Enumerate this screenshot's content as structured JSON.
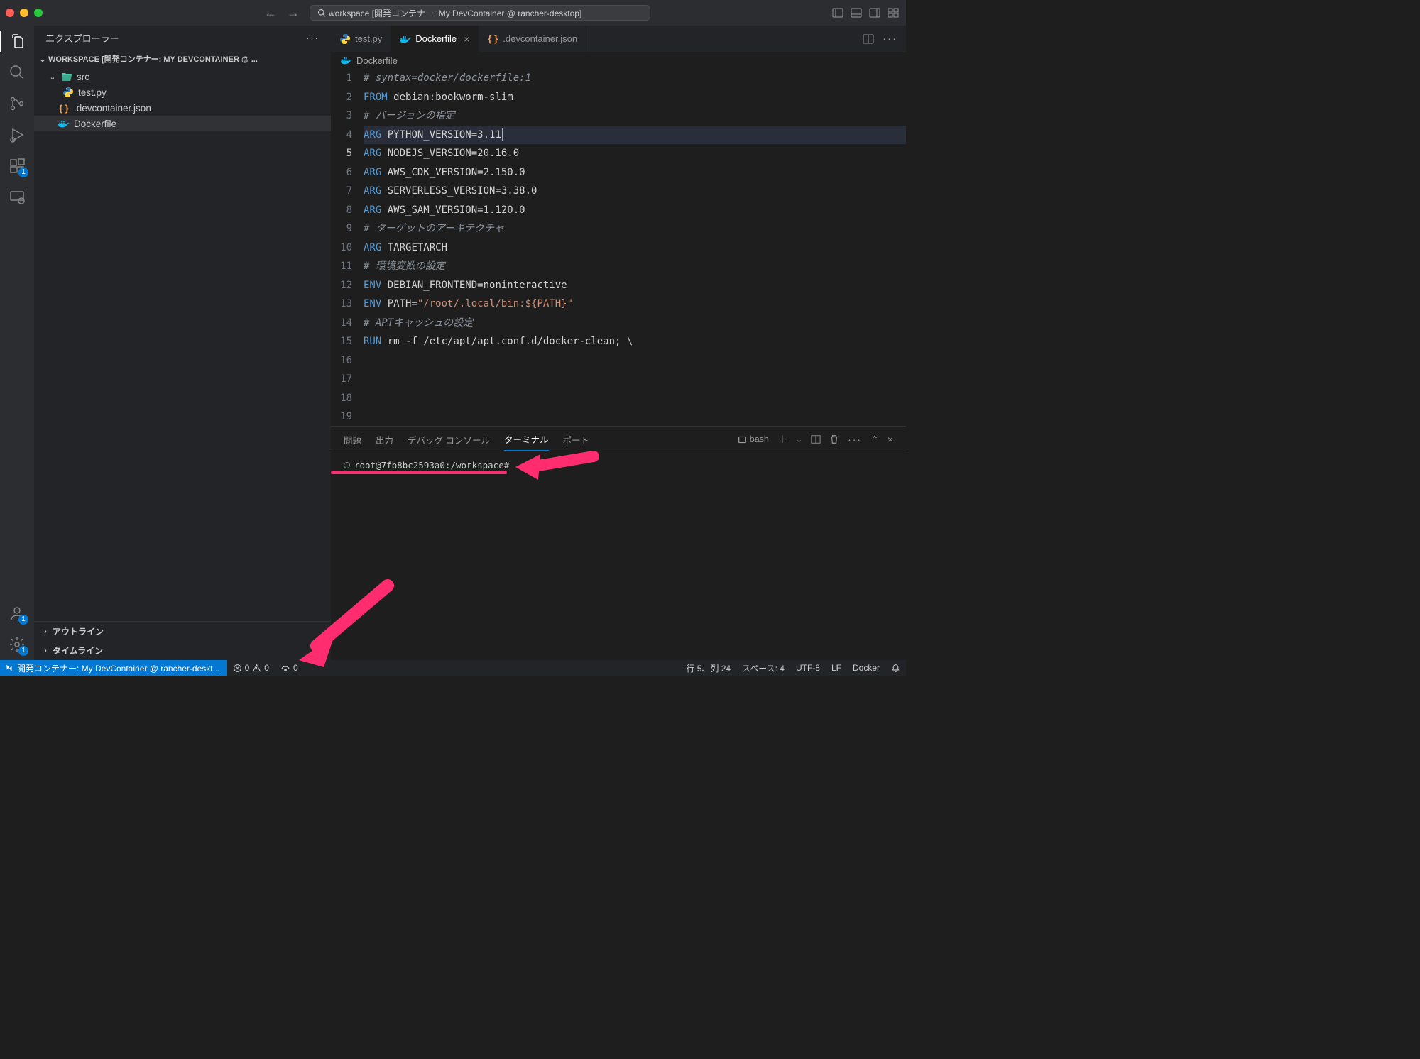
{
  "titlebar": {
    "search_prefix_icon": "search",
    "search_text": "workspace [開発コンテナー: My DevContainer @ rancher-desktop]"
  },
  "sidebar": {
    "title": "エクスプローラー",
    "workspace_label": "WORKSPACE [開発コンテナー: MY DEVCONTAINER @ ...",
    "tree": {
      "src_label": "src",
      "testpy_label": "test.py",
      "devcontainer_label": ".devcontainer.json",
      "dockerfile_label": "Dockerfile"
    },
    "outline": "アウトライン",
    "timeline": "タイムライン"
  },
  "tabs": {
    "tab1": "test.py",
    "tab2": "Dockerfile",
    "tab3": ".devcontainer.json"
  },
  "breadcrumb": {
    "file": "Dockerfile"
  },
  "code": {
    "lines": [
      {
        "n": "1",
        "pre": "# syntax=docker/dockerfile:1",
        "cls": "cmt"
      },
      {
        "n": "2",
        "kw": "FROM",
        "rest": " debian:bookworm-slim"
      },
      {
        "n": "3",
        "pre": ""
      },
      {
        "n": "4",
        "pre": "# バージョンの指定",
        "cls": "cmt"
      },
      {
        "n": "5",
        "kw": "ARG",
        "rest": " PYTHON_VERSION=3.11",
        "hl": true
      },
      {
        "n": "6",
        "kw": "ARG",
        "rest": " NODEJS_VERSION=20.16.0"
      },
      {
        "n": "7",
        "kw": "ARG",
        "rest": " AWS_CDK_VERSION=2.150.0"
      },
      {
        "n": "8",
        "kw": "ARG",
        "rest": " SERVERLESS_VERSION=3.38.0"
      },
      {
        "n": "9",
        "kw": "ARG",
        "rest": " AWS_SAM_VERSION=1.120.0"
      },
      {
        "n": "10",
        "pre": ""
      },
      {
        "n": "11",
        "pre": "# ターゲットのアーキテクチャ",
        "cls": "cmt"
      },
      {
        "n": "12",
        "kw": "ARG",
        "rest": " TARGETARCH"
      },
      {
        "n": "13",
        "pre": ""
      },
      {
        "n": "14",
        "pre": "# 環境変数の設定",
        "cls": "cmt"
      },
      {
        "n": "15",
        "kw": "ENV",
        "rest": " DEBIAN_FRONTEND=noninteractive"
      },
      {
        "n": "16",
        "kw": "ENV",
        "rest_pre": " PATH=",
        "str": "\"/root/.local/bin:${PATH}\""
      },
      {
        "n": "17",
        "pre": ""
      },
      {
        "n": "18",
        "pre": "# APTキャッシュの設定",
        "cls": "cmt"
      },
      {
        "n": "19",
        "kw": "RUN",
        "rest": " rm -f /etc/apt/apt.conf.d/docker-clean; \\"
      }
    ]
  },
  "panel": {
    "tabs": {
      "problems": "問題",
      "output": "出力",
      "debug_console": "デバッグ コンソール",
      "terminal": "ターミナル",
      "ports": "ポート"
    },
    "shell_label": "bash",
    "prompt": "root@7fb8bc2593a0:/workspace#"
  },
  "statusbar": {
    "remote": "開発コンテナー: My DevContainer @ rancher-deskt...",
    "errors": "0",
    "warnings": "0",
    "ports": "0",
    "ln_col": "行 5、列 24",
    "spaces": "スペース: 4",
    "encoding": "UTF-8",
    "eol": "LF",
    "lang": "Docker"
  },
  "badges": {
    "ext": "1",
    "account": "1",
    "gear": "1"
  }
}
